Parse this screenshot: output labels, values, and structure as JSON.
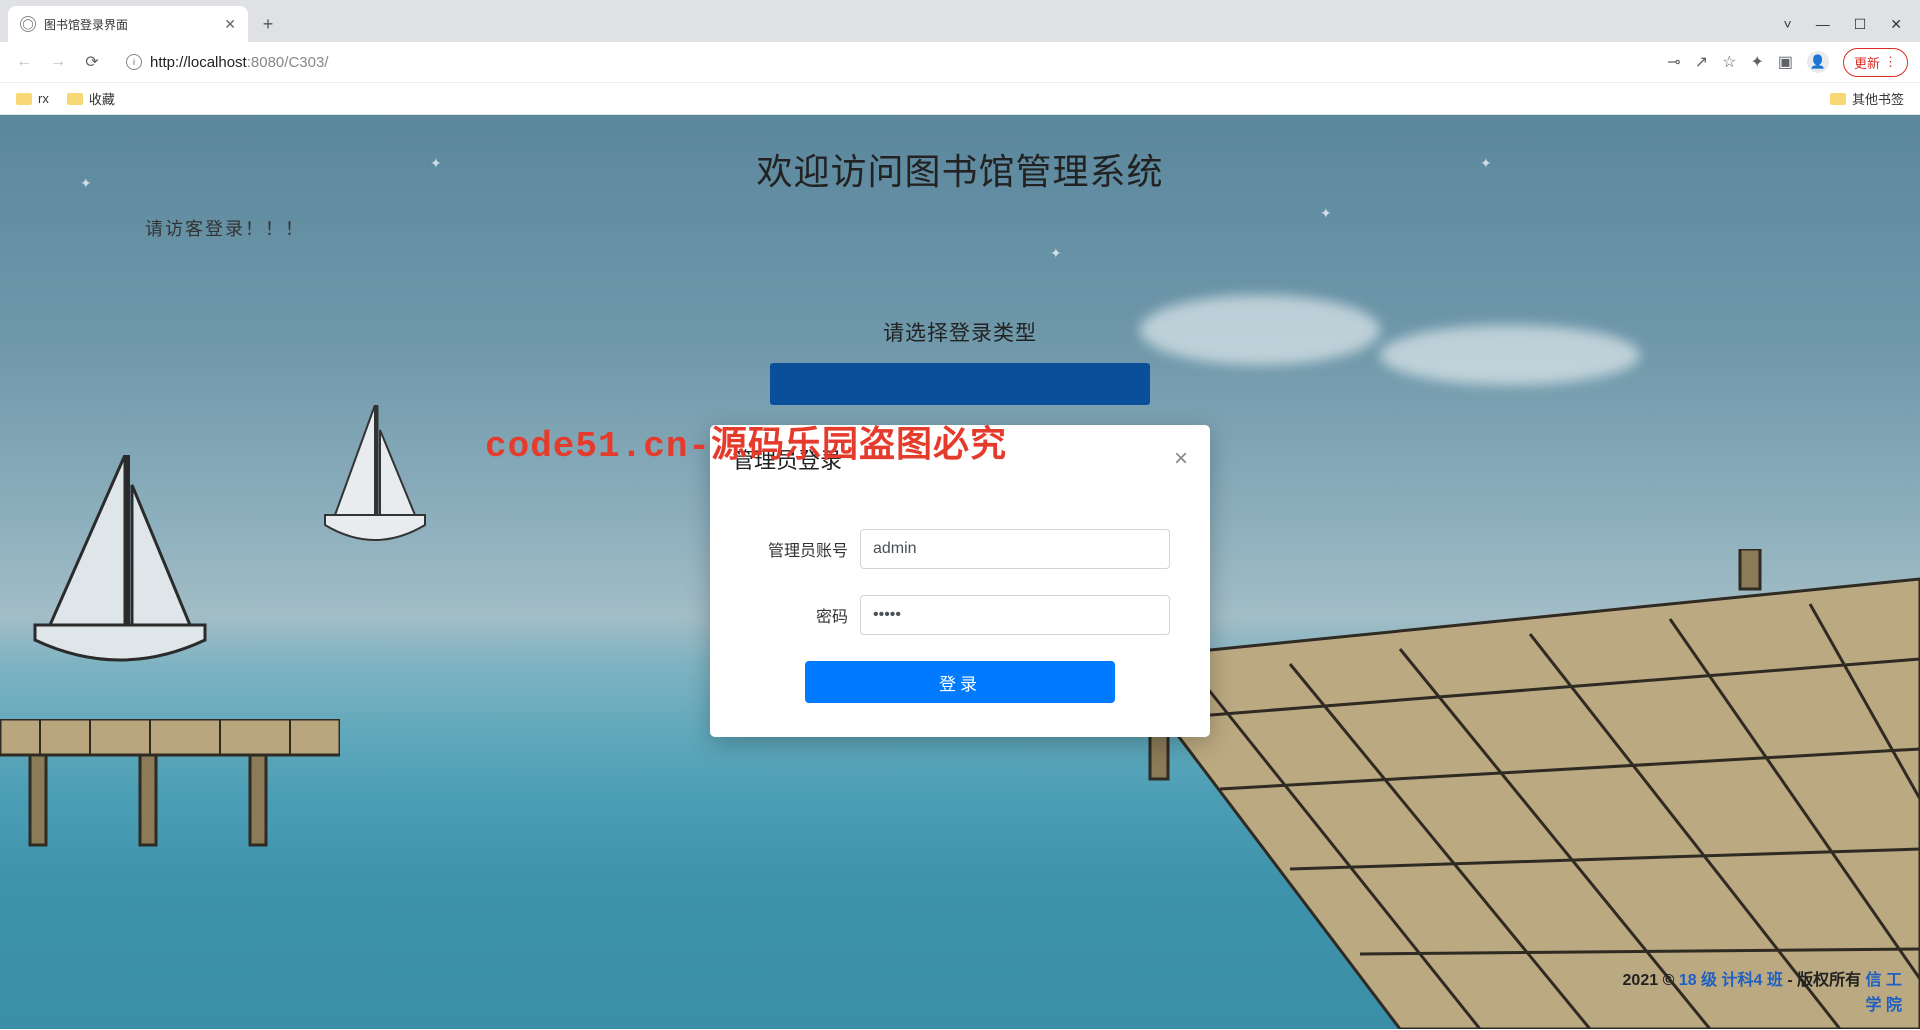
{
  "browser": {
    "tab_title": "图书馆登录界面",
    "new_tab_label": "+",
    "window": {
      "min": "—",
      "max": "☐",
      "close": "✕",
      "dropdown": "˅"
    },
    "url_display_host": "http://localhost",
    "url_display_port_path": ":8080/C303/",
    "update_label": "更新",
    "bookmarks": [
      {
        "label": "rx"
      },
      {
        "label": "收藏"
      }
    ],
    "other_bookmarks": "其他书签",
    "icons": {
      "key": "⊸",
      "share": "↗",
      "star": "☆",
      "ext": "✦",
      "panel": "▣",
      "menu": "⋮"
    }
  },
  "page": {
    "headline": "欢迎访问图书馆管理系统",
    "sub_note": "请访客登录！！！",
    "login_type_title": "请选择登录类型"
  },
  "modal": {
    "title": "管理员登录",
    "close": "×",
    "username_label": "管理员账号",
    "username_value": "admin",
    "password_label": "密码",
    "password_value": "•••••",
    "login_button": "登录"
  },
  "watermark": "code51.cn-源码乐园盗图必究",
  "footer": {
    "line1_prefix": "2021 © ",
    "line1_link1": "18 级 计科4 班",
    "line1_mid": " - 版权所有   ",
    "line1_link2": "信 工",
    "line2_link": "学 院"
  }
}
